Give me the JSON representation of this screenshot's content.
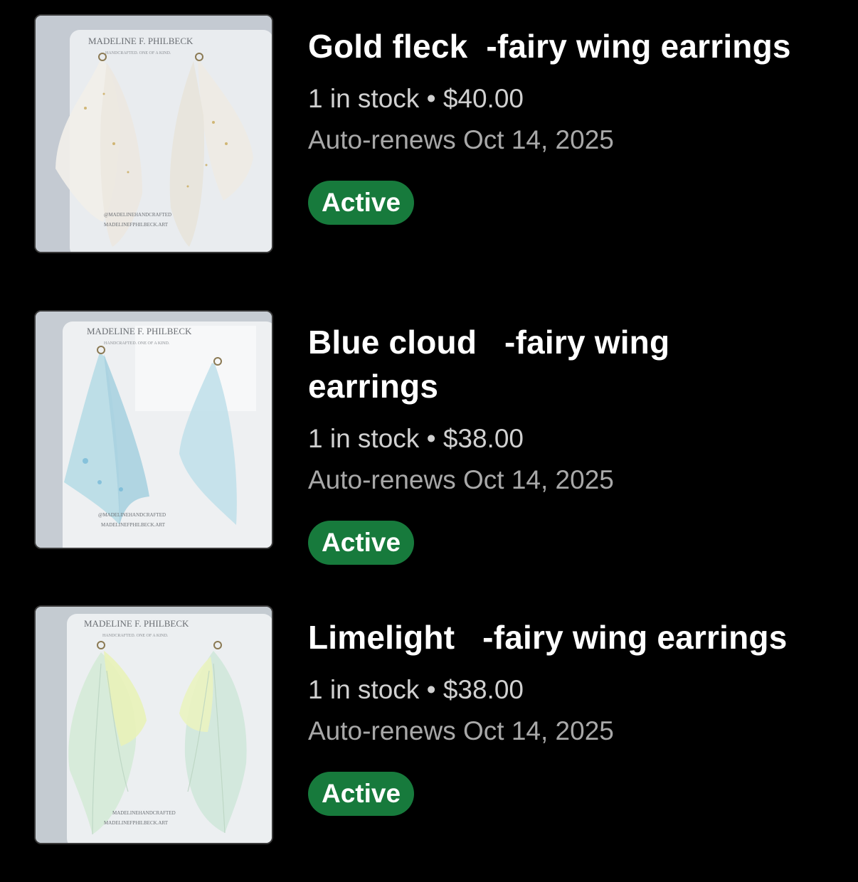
{
  "colors": {
    "background": "#000000",
    "active_badge": "#177a3c",
    "title_text": "#ffffff",
    "meta_text": "#d0d0d0",
    "renew_text": "#a8a8a8"
  },
  "listings": [
    {
      "title": "Gold fleck  -fairy wing earrings",
      "stock": "1 in stock",
      "separator": "•",
      "price": "$40.00",
      "renew": "Auto-renews Oct 14, 2025",
      "status": "Active",
      "card_brand": "MADELINE F. PHILBECK",
      "card_tagline": "HANDCRAFTED. ONE OF A KIND.",
      "card_handle": "@MADELINEHANDCRAFTED",
      "card_site": "MADELINEFPHILBECK.ART"
    },
    {
      "title": "Blue cloud   -fairy wing earrings",
      "stock": "1 in stock",
      "separator": "•",
      "price": "$38.00",
      "renew": "Auto-renews Oct 14, 2025",
      "status": "Active",
      "card_brand": "MADELINE F. PHILBECK",
      "card_tagline": "HANDCRAFTED. ONE OF A KIND.",
      "card_handle": "@MADELINEHANDCRAFTED",
      "card_site": "MADELINEFPHILBECK.ART"
    },
    {
      "title": "Limelight   -fairy wing earrings",
      "stock": "1 in stock",
      "separator": "•",
      "price": "$38.00",
      "renew": "Auto-renews Oct 14, 2025",
      "status": "Active",
      "card_brand": "MADELINE F. PHILBECK",
      "card_tagline": "HANDCRAFTED. ONE OF A KIND.",
      "card_handle": "MADELINEHANDCRAFTED",
      "card_site": "MADELINEFPHILBECK.ART"
    }
  ]
}
